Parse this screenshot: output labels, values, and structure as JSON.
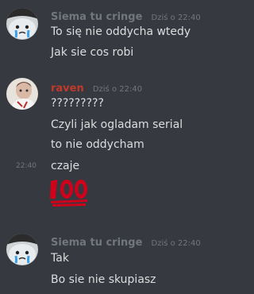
{
  "colors": {
    "background": "#36393f",
    "text": "#dcddde",
    "timestamp": "#72767d",
    "siema_name": "#72767d",
    "raven_name": "#c0392b",
    "hundred_red": "#d0021b"
  },
  "messages": [
    {
      "author": "Siema tu cringe",
      "timestamp": "Dziś o 22:40",
      "avatar_icon": "crying-blob-avatar-icon",
      "lines": [
        "To się nie oddycha wtedy",
        "Jak sie cos robi"
      ]
    },
    {
      "author": "raven",
      "timestamp": "Dziś o 22:40",
      "avatar_icon": "raven-avatar-icon",
      "lines": [
        "?????????",
        "Czyli jak ogladam serial",
        "to nie oddycham",
        "czaje"
      ],
      "hover_timestamp": "22:40",
      "emoji": "100-emoji-icon"
    },
    {
      "author": "Siema tu cringe",
      "timestamp": "Dziś o 22:40",
      "avatar_icon": "crying-blob-avatar-icon",
      "lines": [
        "Tak",
        "Bo sie nie skupiasz"
      ]
    }
  ]
}
